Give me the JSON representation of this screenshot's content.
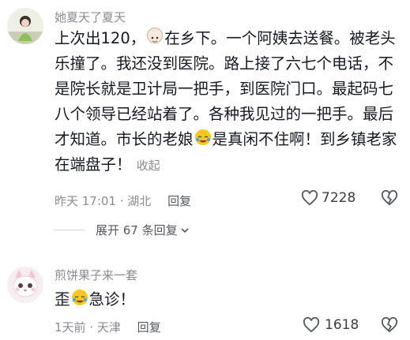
{
  "comments": [
    {
      "username": "她夏天了夏天",
      "segments": {
        "s1": "上次出120，",
        "s2": "在乡下。一个阿姨去送餐。被老头乐撞了。我还没到医院。路上接了六七个电话，不是院长就是卫计局一把手，到医院门口。最起码七八个领导已经站着了。各种我见过的一把手。最后才知道。市长的老娘",
        "s3": "是真闲不住啊！到乡镇老家在端盘子！"
      },
      "fold_label": "收起",
      "time_location": "昨天 17:01 · 湖北",
      "reply_label": "回复",
      "like_count": "7228"
    },
    {
      "username": "煎饼果子来一套",
      "segments": {
        "s1": "歪",
        "s2": "急诊！"
      },
      "time_location": "1天前 · 天津",
      "reply_label": "回复",
      "like_count": "1618"
    }
  ],
  "expand_replies_label": "展开 67 条回复",
  "icons": {
    "emoji_1": "cat-face-emoji",
    "emoji_2": "crying-laughing-emoji",
    "emoji_3": "crying-laughing-emoji",
    "like": "heart-outline-icon",
    "dislike": "broken-heart-icon",
    "expand": "chevron-down-icon"
  }
}
